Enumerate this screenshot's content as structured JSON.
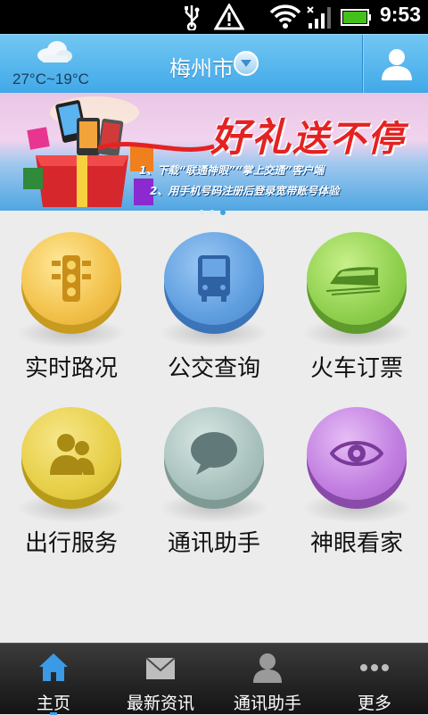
{
  "status_bar": {
    "time": "9:53",
    "icons": [
      "usb-icon",
      "warning-icon",
      "wifi-icon",
      "signal-icon",
      "battery-icon"
    ]
  },
  "header": {
    "temperature": "27°C~19°C",
    "city": "梅州市",
    "weather_icon": "cloud-icon",
    "user_icon": "user-icon"
  },
  "banner": {
    "title_part1": "好礼",
    "title_part2": "送不停",
    "line1": "1、下载“联通神眼”“掌上交通”客户端",
    "line2": "2、用手机号码注册后登录宽带账号体验",
    "active_dot": 0
  },
  "grid": {
    "tiles": [
      {
        "label": "实时路况",
        "icon": "traffic-light-icon",
        "color": "#f4c850"
      },
      {
        "label": "公交查询",
        "icon": "bus-icon",
        "color": "#5f9fe0"
      },
      {
        "label": "火车订票",
        "icon": "train-icon",
        "color": "#8fd04e"
      },
      {
        "label": "出行服务",
        "icon": "people-icon",
        "color": "#e7cf47"
      },
      {
        "label": "通讯助手",
        "icon": "chat-bubble-icon",
        "color": "#a9c2be"
      },
      {
        "label": "神眼看家",
        "icon": "eye-icon",
        "color": "#c17ee0"
      }
    ]
  },
  "tabbar": {
    "tabs": [
      {
        "label": "主页",
        "icon": "home-icon",
        "active": true
      },
      {
        "label": "最新资讯",
        "icon": "mail-icon",
        "active": false
      },
      {
        "label": "通讯助手",
        "icon": "contact-icon",
        "active": false
      },
      {
        "label": "更多",
        "icon": "more-icon",
        "active": false
      }
    ]
  }
}
